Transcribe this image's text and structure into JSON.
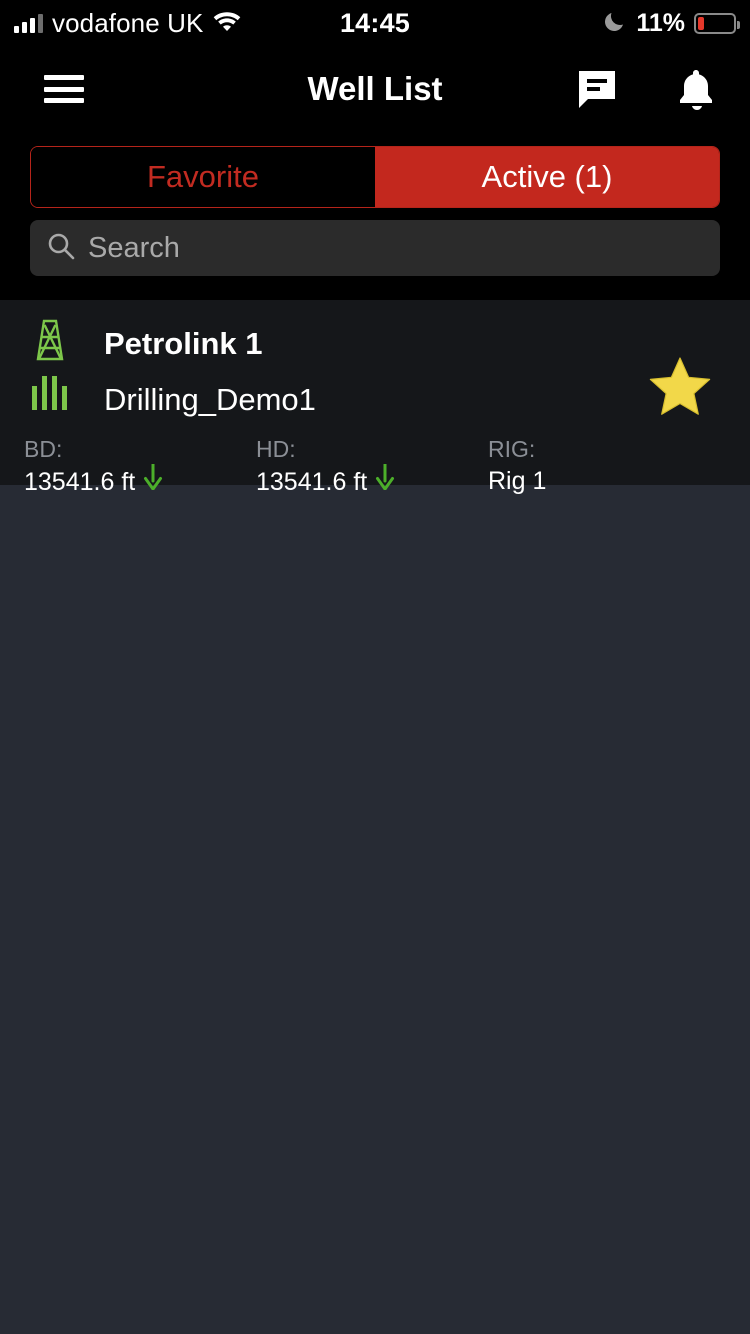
{
  "status_bar": {
    "carrier": "vodafone UK",
    "time": "14:45",
    "battery_percent": "11%",
    "battery_level": 11,
    "signal_icon": "signal-bars-icon",
    "wifi_icon": "wifi-icon",
    "moon_icon": "moon-icon",
    "battery_icon": "battery-icon"
  },
  "header": {
    "title": "Well List",
    "menu_icon": "hamburger-menu-icon",
    "chat_icon": "chat-bubble-icon",
    "bell_icon": "notification-bell-icon"
  },
  "tabs": [
    {
      "label": "Favorite",
      "active": false
    },
    {
      "label": "Active (1)",
      "active": true
    }
  ],
  "search": {
    "placeholder": "Search",
    "value": "",
    "icon": "search-icon"
  },
  "wells": [
    {
      "name": "Petrolink 1",
      "wellbore": "Drilling_Demo1",
      "favorite": true,
      "rig_icon": "derrick-icon",
      "log_icon": "well-log-icon",
      "star_icon": "star-filled-icon",
      "metrics": [
        {
          "label": "BD:",
          "value": "13541.6 ft",
          "trend": "down"
        },
        {
          "label": "HD:",
          "value": "13541.6 ft",
          "trend": "down"
        },
        {
          "label": "RIG:",
          "value": "Rig 1",
          "trend": "none"
        }
      ]
    }
  ],
  "colors": {
    "accent_red": "#c3281e",
    "accent_green": "#7dc74a",
    "star_yellow": "#f2d849",
    "page_background": "#272b34",
    "card_background": "#15171a",
    "bar_background": "#000000"
  }
}
